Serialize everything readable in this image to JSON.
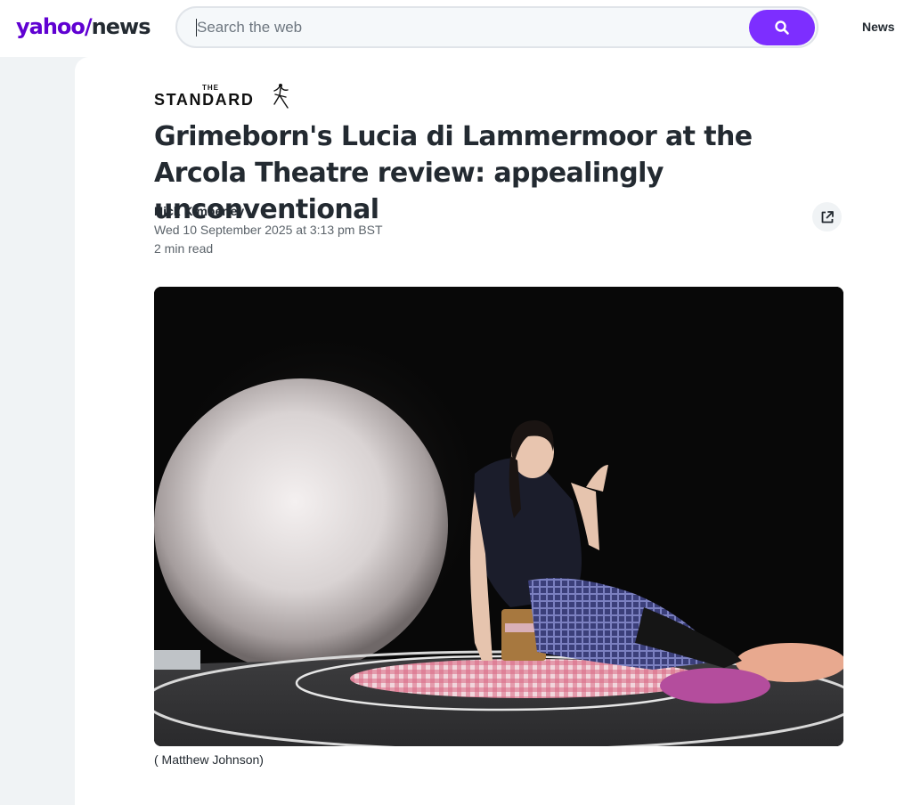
{
  "header": {
    "logo_primary": "yahoo/",
    "logo_secondary": "news",
    "search": {
      "placeholder": "Search the web",
      "button_icon": "search-icon"
    },
    "nav_link": "News",
    "brand_color": "#6001d2",
    "search_button_color": "#7d2eff"
  },
  "article": {
    "source": {
      "the": "THE",
      "name": "STANDARD"
    },
    "headline": "Grimeborn's Lucia di Lammermoor at the Arcola Theatre review: appealingly unconventional",
    "author": "Nick Kimberley",
    "date": "Wed 10 September 2025 at 3:13 pm BST",
    "read_time": "2 min read",
    "share_icon": "external-link-icon",
    "image": {
      "description_icon": "stage-photo",
      "caption": "( Matthew Johnson)"
    }
  }
}
